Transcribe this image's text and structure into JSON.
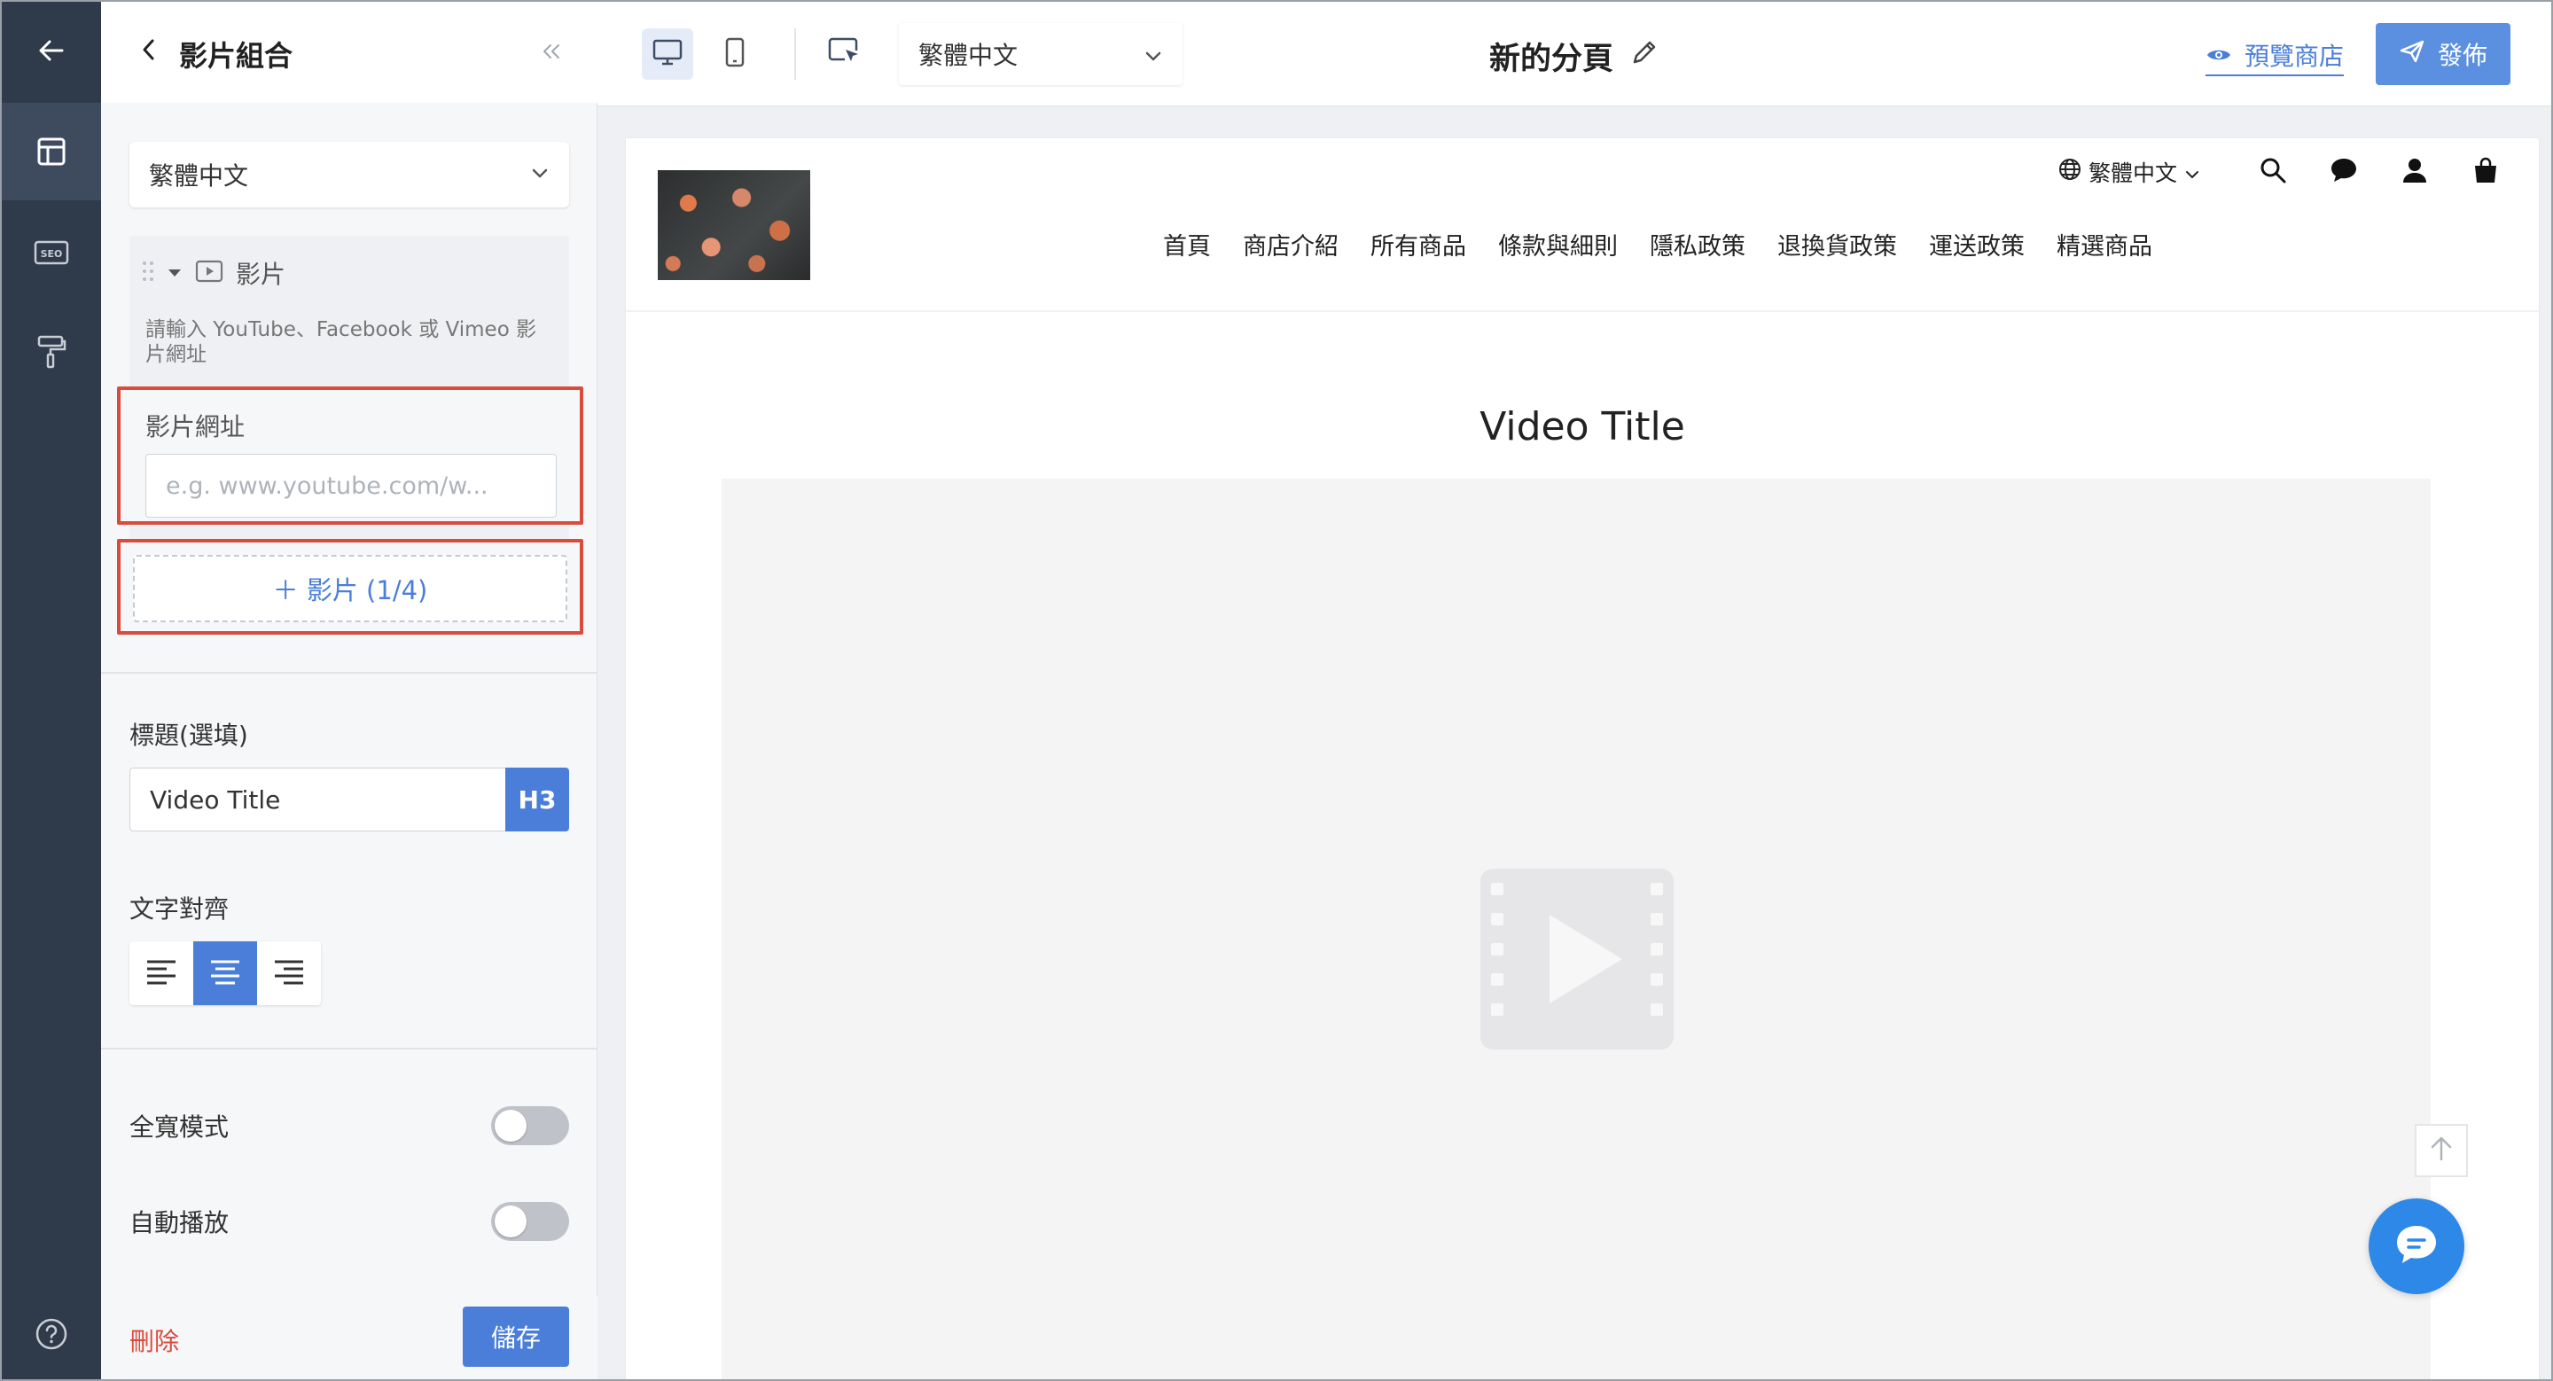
{
  "rail": {
    "items": [
      {
        "icon": "arrow-left-icon"
      },
      {
        "icon": "layout-icon",
        "active": true
      },
      {
        "icon": "seo-icon",
        "text": "SEO"
      },
      {
        "icon": "paint-roller-icon"
      },
      {
        "icon": "help-icon"
      }
    ]
  },
  "panel": {
    "title": "影片組合",
    "language": "繁體中文",
    "block": {
      "title": "影片",
      "hint": "請輸入 YouTube、Facebook 或 Vimeo 影片網址",
      "url_label": "影片網址",
      "url_placeholder": "e.g. www.youtube.com/w...",
      "add_label": "＋ 影片 (1/4)"
    },
    "heading": {
      "label": "標題(選填)",
      "value": "Video Title",
      "level": "H3"
    },
    "align": {
      "label": "文字對齊",
      "options": [
        "left",
        "center",
        "right"
      ],
      "selected": "center"
    },
    "full_width": {
      "label": "全寬模式",
      "on": false
    },
    "autoplay": {
      "label": "自動播放",
      "on": false
    },
    "delete_label": "刪除",
    "save_label": "儲存"
  },
  "topbar": {
    "language": "繁體中文",
    "page_name": "新的分頁",
    "preview_label": "預覽商店",
    "publish_label": "發佈",
    "accent": "#4a7ed8"
  },
  "store": {
    "language": "繁體中文",
    "nav": [
      "首頁",
      "商店介紹",
      "所有商品",
      "條款與細則",
      "隱私政策",
      "退換貨政策",
      "運送政策",
      "精選商品"
    ],
    "video_title": "Video Title"
  }
}
